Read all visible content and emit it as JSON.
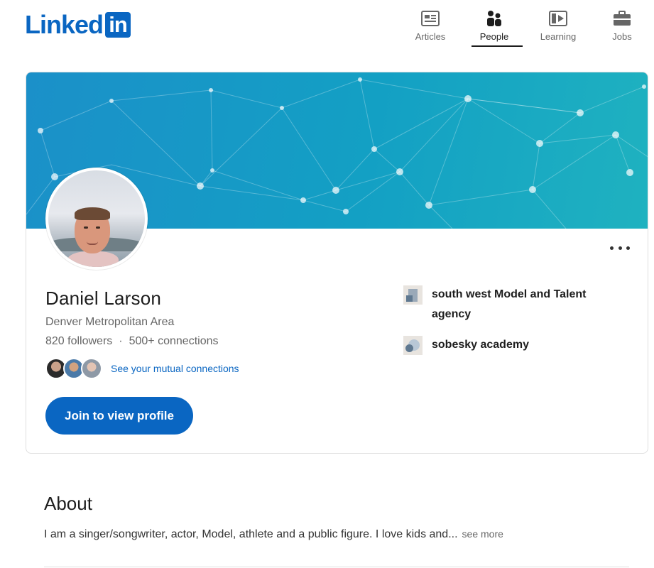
{
  "brand": {
    "logo_word": "Linked",
    "logo_box": "in",
    "color": "#0a66c2"
  },
  "nav": {
    "items": [
      {
        "label": "Articles",
        "icon": "articles-icon",
        "active": false
      },
      {
        "label": "People",
        "icon": "people-icon",
        "active": true
      },
      {
        "label": "Learning",
        "icon": "learning-icon",
        "active": false
      },
      {
        "label": "Jobs",
        "icon": "jobs-icon",
        "active": false
      }
    ]
  },
  "profile": {
    "name": "Daniel Larson",
    "location": "Denver Metropolitan Area",
    "followers": "820 followers",
    "separator": "·",
    "connections": "500+ connections",
    "mutual_link": "See your mutual connections",
    "join_button": "Join to view profile",
    "experience": [
      {
        "name": "south west Model and Talent agency",
        "logo_icon": "company-logo-icon"
      },
      {
        "name": "sobesky academy",
        "logo_icon": "school-logo-icon"
      }
    ]
  },
  "about": {
    "title": "About",
    "text": "I am a singer/songwriter, actor, Model, athlete and a public figure. I love kids and...",
    "see_more": "see more"
  }
}
